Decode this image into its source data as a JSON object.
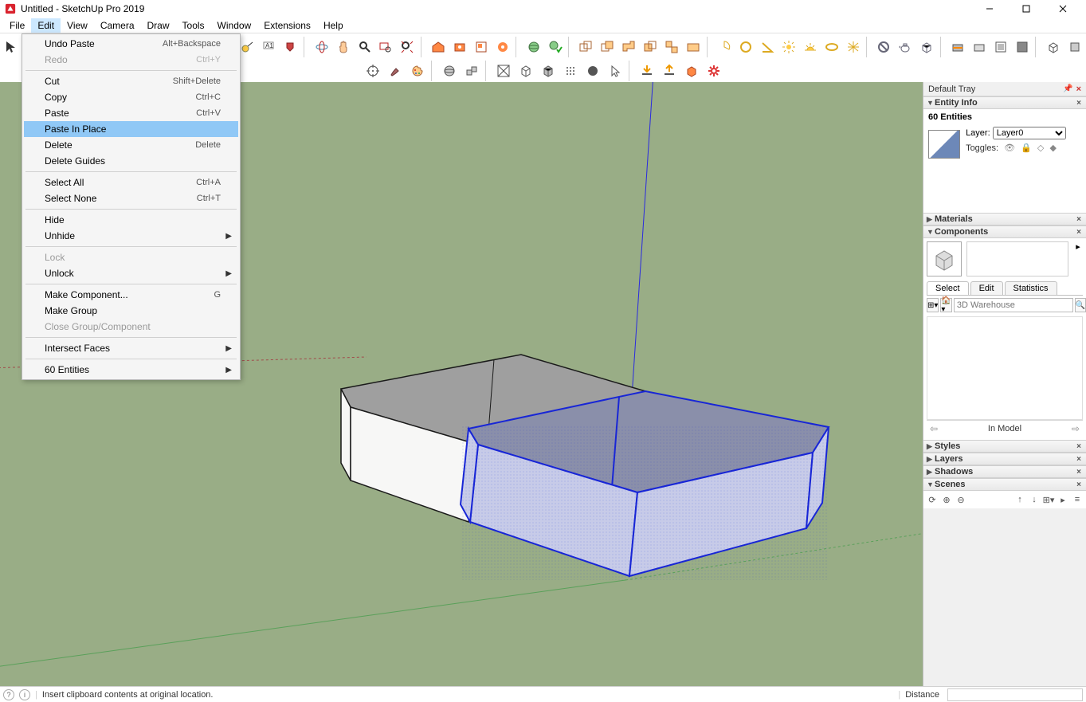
{
  "window": {
    "title": "Untitled - SketchUp Pro 2019"
  },
  "menubar": [
    "File",
    "Edit",
    "View",
    "Camera",
    "Draw",
    "Tools",
    "Window",
    "Extensions",
    "Help"
  ],
  "active_menu_index": 1,
  "edit_menu": {
    "groups": [
      [
        {
          "label": "Undo Paste",
          "shortcut": "Alt+Backspace",
          "enabled": true
        },
        {
          "label": "Redo",
          "shortcut": "Ctrl+Y",
          "enabled": false
        }
      ],
      [
        {
          "label": "Cut",
          "shortcut": "Shift+Delete",
          "enabled": true
        },
        {
          "label": "Copy",
          "shortcut": "Ctrl+C",
          "enabled": true
        },
        {
          "label": "Paste",
          "shortcut": "Ctrl+V",
          "enabled": true
        },
        {
          "label": "Paste In Place",
          "shortcut": "",
          "enabled": true,
          "hover": true
        },
        {
          "label": "Delete",
          "shortcut": "Delete",
          "enabled": true
        },
        {
          "label": "Delete Guides",
          "shortcut": "",
          "enabled": true
        }
      ],
      [
        {
          "label": "Select All",
          "shortcut": "Ctrl+A",
          "enabled": true
        },
        {
          "label": "Select None",
          "shortcut": "Ctrl+T",
          "enabled": true
        }
      ],
      [
        {
          "label": "Hide",
          "shortcut": "",
          "enabled": true
        },
        {
          "label": "Unhide",
          "shortcut": "",
          "enabled": true,
          "submenu": true
        }
      ],
      [
        {
          "label": "Lock",
          "shortcut": "",
          "enabled": false
        },
        {
          "label": "Unlock",
          "shortcut": "",
          "enabled": true,
          "submenu": true
        }
      ],
      [
        {
          "label": "Make Component...",
          "shortcut": "G",
          "enabled": true
        },
        {
          "label": "Make Group",
          "shortcut": "",
          "enabled": true
        },
        {
          "label": "Close Group/Component",
          "shortcut": "",
          "enabled": false
        }
      ],
      [
        {
          "label": "Intersect Faces",
          "shortcut": "",
          "enabled": true,
          "submenu": true
        }
      ],
      [
        {
          "label": "60 Entities",
          "shortcut": "",
          "enabled": true,
          "submenu": true
        }
      ]
    ]
  },
  "tray": {
    "title": "Default Tray",
    "entity_info": {
      "title": "Entity Info",
      "count": "60 Entities",
      "layer_label": "Layer:",
      "layer_value": "Layer0",
      "toggles_label": "Toggles:"
    },
    "materials": {
      "title": "Materials"
    },
    "components": {
      "title": "Components",
      "tabs": [
        "Select",
        "Edit",
        "Statistics"
      ],
      "active_tab": 0,
      "search_placeholder": "3D Warehouse",
      "nav_label": "In Model"
    },
    "styles": {
      "title": "Styles"
    },
    "layers": {
      "title": "Layers"
    },
    "shadows": {
      "title": "Shadows"
    },
    "scenes": {
      "title": "Scenes"
    }
  },
  "statusbar": {
    "hint": "Insert clipboard contents at original location.",
    "distance_label": "Distance"
  },
  "colors": {
    "viewport_bg": "#99ad86",
    "selection": "#1826d6",
    "grey_face": "#9f9f9f",
    "white_face": "#f7f7f6"
  }
}
